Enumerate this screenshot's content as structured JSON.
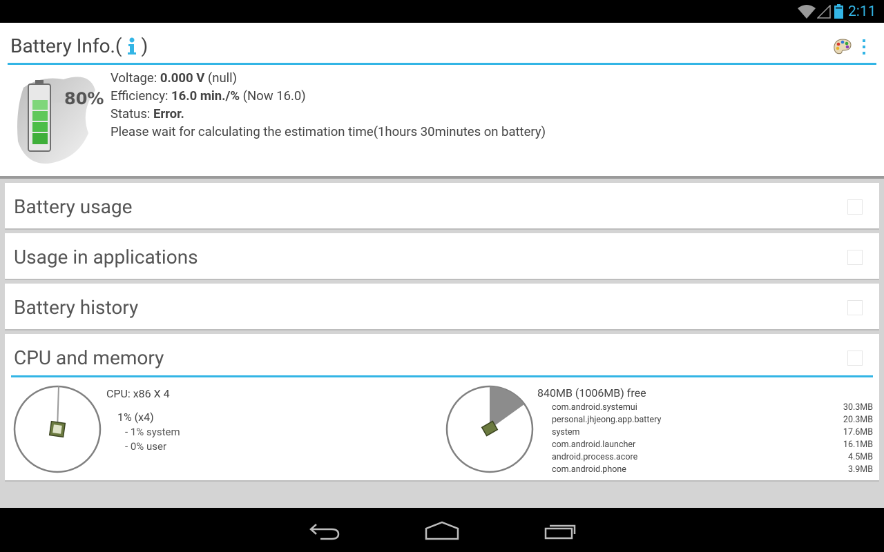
{
  "status_bar": {
    "time": "2:11"
  },
  "header": {
    "title_prefix": "Battery Info.(",
    "title_suffix": ")",
    "battery_percent": "80%",
    "voltage_label": "Voltage:",
    "voltage_value": "0.000 V",
    "voltage_extra": "(null)",
    "efficiency_label": "Efficiency:",
    "efficiency_value": "16.0 min./%",
    "efficiency_extra": "(Now 16.0)",
    "status_label": "Status:",
    "status_value": "Error.",
    "estimate_text": "Please wait for calculating the estimation time(1hours 30minutes on battery)"
  },
  "sections": [
    {
      "label": "Battery usage"
    },
    {
      "label": "Usage in applications"
    },
    {
      "label": "Battery history"
    },
    {
      "label": "CPU and memory"
    }
  ],
  "cpu": {
    "label": "CPU: x86 X 4",
    "usage": "1% (x4)",
    "system": "- 1% system",
    "user": "- 0% user"
  },
  "memory": {
    "summary": "840MB (1006MB) free",
    "processes": [
      {
        "name": "com.android.systemui",
        "size": "30.3MB"
      },
      {
        "name": "personal.jhjeong.app.battery",
        "size": "20.3MB"
      },
      {
        "name": "system",
        "size": "17.6MB"
      },
      {
        "name": "com.android.launcher",
        "size": "16.1MB"
      },
      {
        "name": "android.process.acore",
        "size": "4.5MB"
      },
      {
        "name": "com.android.phone",
        "size": "3.9MB"
      }
    ]
  },
  "colors": {
    "accent": "#33b5e5",
    "status_bar": "#000000",
    "background": "#d4d4d4"
  },
  "icons": [
    "wifi-icon",
    "signal-icon",
    "battery-status-icon",
    "info-icon",
    "palette-icon",
    "overflow-menu-icon",
    "back-icon",
    "home-icon",
    "recents-icon",
    "cpu-chip-icon"
  ]
}
